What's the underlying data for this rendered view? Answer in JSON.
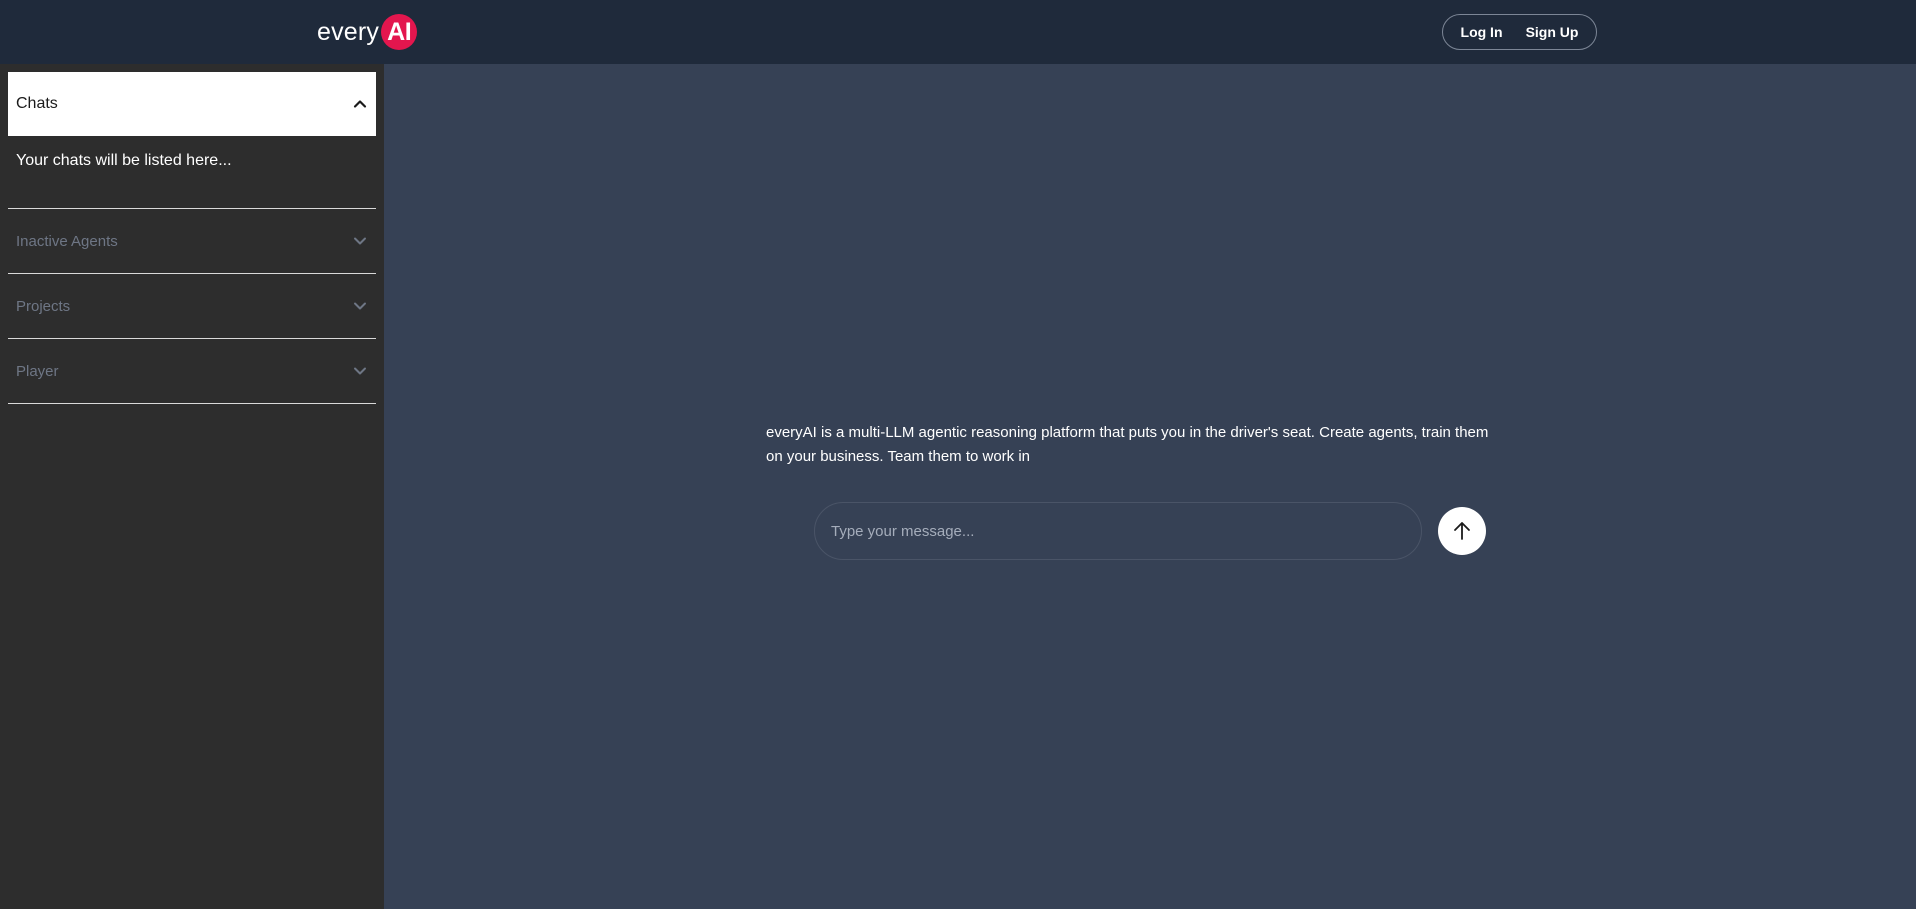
{
  "header": {
    "logo_word": "every",
    "logo_badge": "AI",
    "login_label": "Log In",
    "signup_label": "Sign Up"
  },
  "sidebar": {
    "chats": {
      "title": "Chats",
      "empty_text": "Your chats will be listed here...",
      "icon": "chevron-up-icon"
    },
    "sections": [
      {
        "title": "Inactive Agents",
        "icon": "chevron-down-icon"
      },
      {
        "title": "Projects",
        "icon": "chevron-down-icon"
      },
      {
        "title": "Player",
        "icon": "chevron-down-icon"
      }
    ]
  },
  "main": {
    "intro_text": "everyAI is a multi-LLM agentic reasoning platform that puts you in the driver's seat. Create agents, train them on your business. Team them to work in",
    "message_placeholder": "Type your message...",
    "message_value": "",
    "send_icon": "arrow-up-icon"
  },
  "colors": {
    "topbar": "#1f2a3b",
    "sidebar": "#2d2d2d",
    "main": "#364155",
    "brand_accent": "#e3164e"
  }
}
